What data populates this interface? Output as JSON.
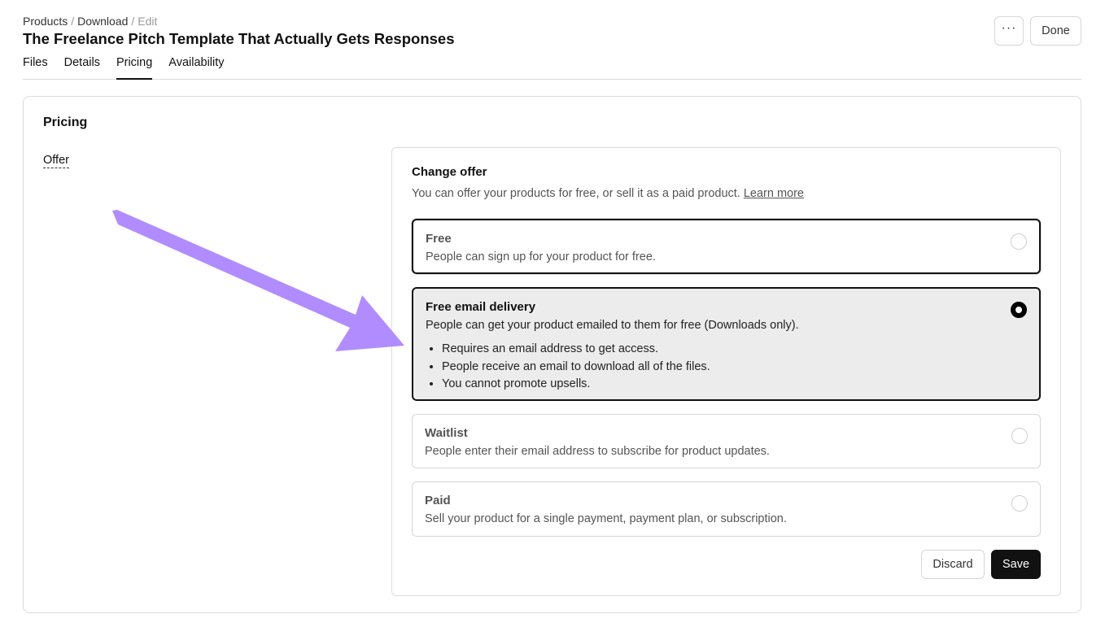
{
  "header": {
    "breadcrumb": [
      "Products",
      "Download",
      "Edit"
    ],
    "title": "The Freelance Pitch Template That Actually Gets Responses",
    "tabs": [
      {
        "label": "Files"
      },
      {
        "label": "Details"
      },
      {
        "label": "Pricing",
        "active": true
      },
      {
        "label": "Availability"
      }
    ],
    "more_label": "···",
    "done_label": "Done"
  },
  "pricing": {
    "section_title": "Pricing",
    "offer_label": "Offer",
    "panel": {
      "title": "Change offer",
      "subtitle": "You can offer your products for free, or sell it as a paid product.",
      "learn_more": "Learn more",
      "options": [
        {
          "title": "Free",
          "description": "People can sign up for your product for free.",
          "selected": false
        },
        {
          "title": "Free email delivery",
          "description": "People can get your product emailed to them for free (Downloads only).",
          "selected": true,
          "bullets": [
            "Requires an email address to get access.",
            "People receive an email to download all of the files.",
            "You cannot promote upsells."
          ]
        },
        {
          "title": "Waitlist",
          "description": "People enter their email address to subscribe for product updates.",
          "selected": false
        },
        {
          "title": "Paid",
          "description": "Sell your product for a single payment, payment plan, or subscription.",
          "selected": false
        }
      ],
      "discard_label": "Discard",
      "save_label": "Save"
    }
  },
  "colors": {
    "accent_arrow": "#b18cff",
    "primary_button": "#111111",
    "selected_background": "#ececec"
  },
  "icons": {
    "more": "more-horizontal-icon",
    "annotation": "arrow-annotation"
  }
}
